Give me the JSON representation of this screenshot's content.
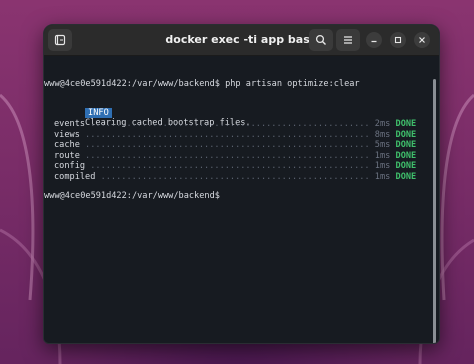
{
  "window": {
    "title": "docker exec -ti app bash"
  },
  "titlebar": {
    "new_tab_icon": "new-tab-icon",
    "search_icon": "search-icon",
    "menu_icon": "hamburger-menu-icon",
    "minimize_icon": "minimize-icon",
    "maximize_icon": "maximize-icon",
    "close_icon": "close-icon"
  },
  "terminal": {
    "prompt1": "www@4ce0e591d422:/var/www/backend$ php artisan optimize:clear",
    "info_badge": "INFO",
    "info_text": "Clearing cached bootstrap files.",
    "tasks": [
      {
        "name": "events",
        "dots": " ...................................................... ",
        "time": "2ms",
        "status": "DONE"
      },
      {
        "name": "views",
        "dots": " ....................................................... ",
        "time": "8ms",
        "status": "DONE"
      },
      {
        "name": "cache",
        "dots": " ....................................................... ",
        "time": "5ms",
        "status": "DONE"
      },
      {
        "name": "route",
        "dots": " ....................................................... ",
        "time": "1ms",
        "status": "DONE"
      },
      {
        "name": "config",
        "dots": " ...................................................... ",
        "time": "1ms",
        "status": "DONE"
      },
      {
        "name": "compiled",
        "dots": " .................................................... ",
        "time": "1ms",
        "status": "DONE"
      }
    ],
    "prompt2": "www@4ce0e591d422:/var/www/backend$"
  },
  "colors": {
    "info_badge_bg": "#2f6fb3",
    "done": "#3fbf6b",
    "terminal_bg": "#171b21",
    "titlebar_bg": "#2b2b2b"
  }
}
